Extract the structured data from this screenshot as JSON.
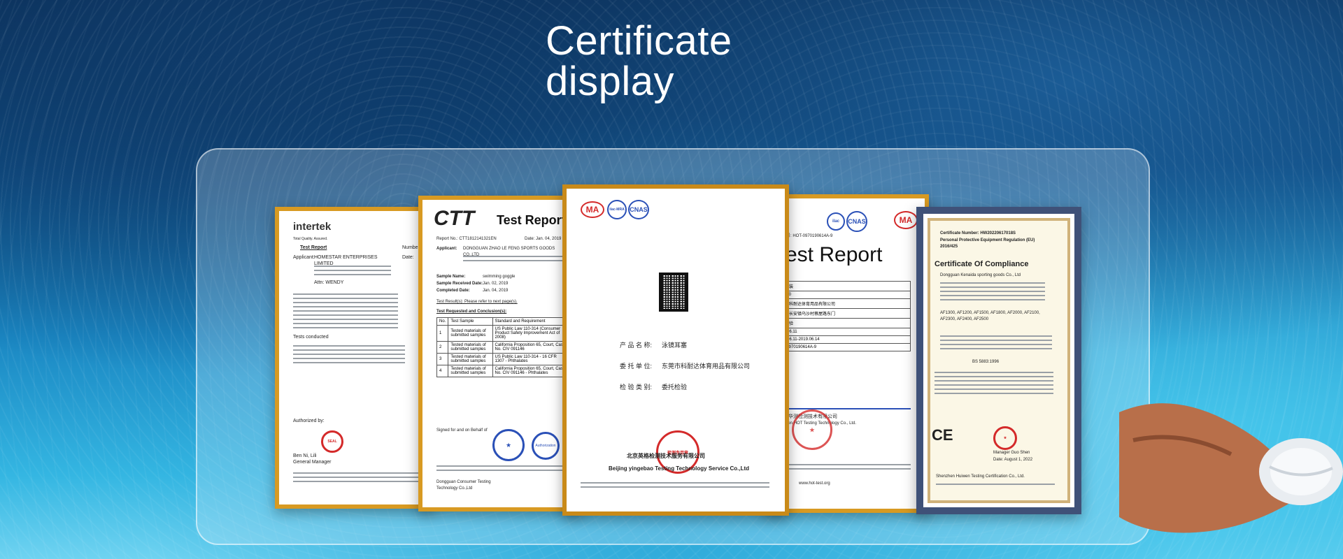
{
  "title": {
    "line1": "Certificate",
    "line2": "display"
  },
  "certificates": [
    {
      "brand": "intertek",
      "brand_tagline": "Total Quality. Assured.",
      "heading": "Test Report",
      "number_label": "Number:",
      "date_label": "Date:",
      "applicant_label": "Applicant:",
      "applicant": "HOMESTAR ENTERPRISES LIMITED",
      "attn": "Attn: WENDY",
      "result_label": "Tests conducted",
      "signature_label": "Authorized by:",
      "signer": "Ben Ni, Lili",
      "signer_title": "General Manager",
      "seal": "SEAL"
    },
    {
      "brand": "CTT",
      "heading": "Test Report",
      "report_no_label": "Report No.: CTT1812141321EN",
      "date_label": "Date: Jan. 04, 2019",
      "applicant_label": "Applicant:",
      "applicant": "DONGGUAN ZHAO LE FENG SPORTS GOODS CO.,LTD",
      "sample_name_label": "Sample Name:",
      "sample_name": "swimming goggle",
      "received_label": "Sample Received Date:",
      "received": "Jan. 02, 2019",
      "completed_label": "Completed Date:",
      "completed": "Jan. 04, 2019",
      "test_result_label": "Test Result(s): Please refer to next page(s).",
      "table_caption": "Test Requested and Conclusion(s):",
      "table_headers": [
        "No.",
        "Test Sample",
        "Standard and Requirement"
      ],
      "table_rows": [
        [
          "1",
          "Tested materials of submitted samples",
          "US Public Law 110-314 (Consumer Product Safety Improvement Act of 2008)"
        ],
        [
          "2",
          "Tested materials of submitted samples",
          "California Proposition 65, Court, Case No. CIV 091146"
        ],
        [
          "3",
          "Tested materials of submitted samples",
          "US Public Law 110-314 - 16 CFR 1307 - Phthalates"
        ],
        [
          "4",
          "Tested materials of submitted samples",
          "California Proposition 65, Court, Case No. CIV 091146 - Phthalates"
        ]
      ],
      "signature_label": "Signed for and on Behalf of",
      "footer": "Dongguan Consumer Testing Technology Co.,Ltd",
      "seal": "Authorization"
    },
    {
      "logos": [
        "MA",
        "ilac-MRA",
        "CNAS"
      ],
      "product_label": "产 品 名 称:",
      "product": "泳镜耳塞",
      "client_label": "委 托 单 位:",
      "client": "东莞市科耐达体育用品有限公司",
      "type_label": "检 验 类 别:",
      "type": "委托检验",
      "issuer_cn": "北京英格检测技术服务有限公司",
      "issuer_en": "Beijing yingebao Testing Technology Service Co.,Ltd",
      "seal": "检测专用章"
    },
    {
      "heading": "Test Report",
      "report_no": "报告编号: HOT-0970190614A-9",
      "rows": [
        "西装套装",
        "AF2600",
        "东莞市科耐达体育用品有限公司",
        "东莞市长安镇乌沙村蔡屋路东门",
        "委托检验",
        "2019.06.11",
        "2019.06.11-2019.06.14",
        "HOT-0970190614A-9"
      ],
      "item_label": "item",
      "issuer_cn": "深圳市华测检测技术有限公司",
      "issuer_en": "Shenzhen HOT Testing Technology Co., Ltd.",
      "website": "www.hot-test.org"
    },
    {
      "cert_number": "Certificate Number: HW20220617018S",
      "regulation": "Personal Protective Equipment Regulation (EU) 2016/425",
      "heading": "Certificate Of Compliance",
      "applicant": "Dongguan Kenaida sporting goods Co., Ltd",
      "models": "AF1300, AF1200, AF1500, AF1800, AF2000, AF2100, AF2300, AF2400, AF2500",
      "standard": "BS 5883:1996",
      "signer": "Manager Guo Shen",
      "date": "Date: August 1, 2022",
      "issuer": "Shenzhen Huiwen Testing Certification Co., Ltd.",
      "ce_mark": "CE"
    }
  ]
}
